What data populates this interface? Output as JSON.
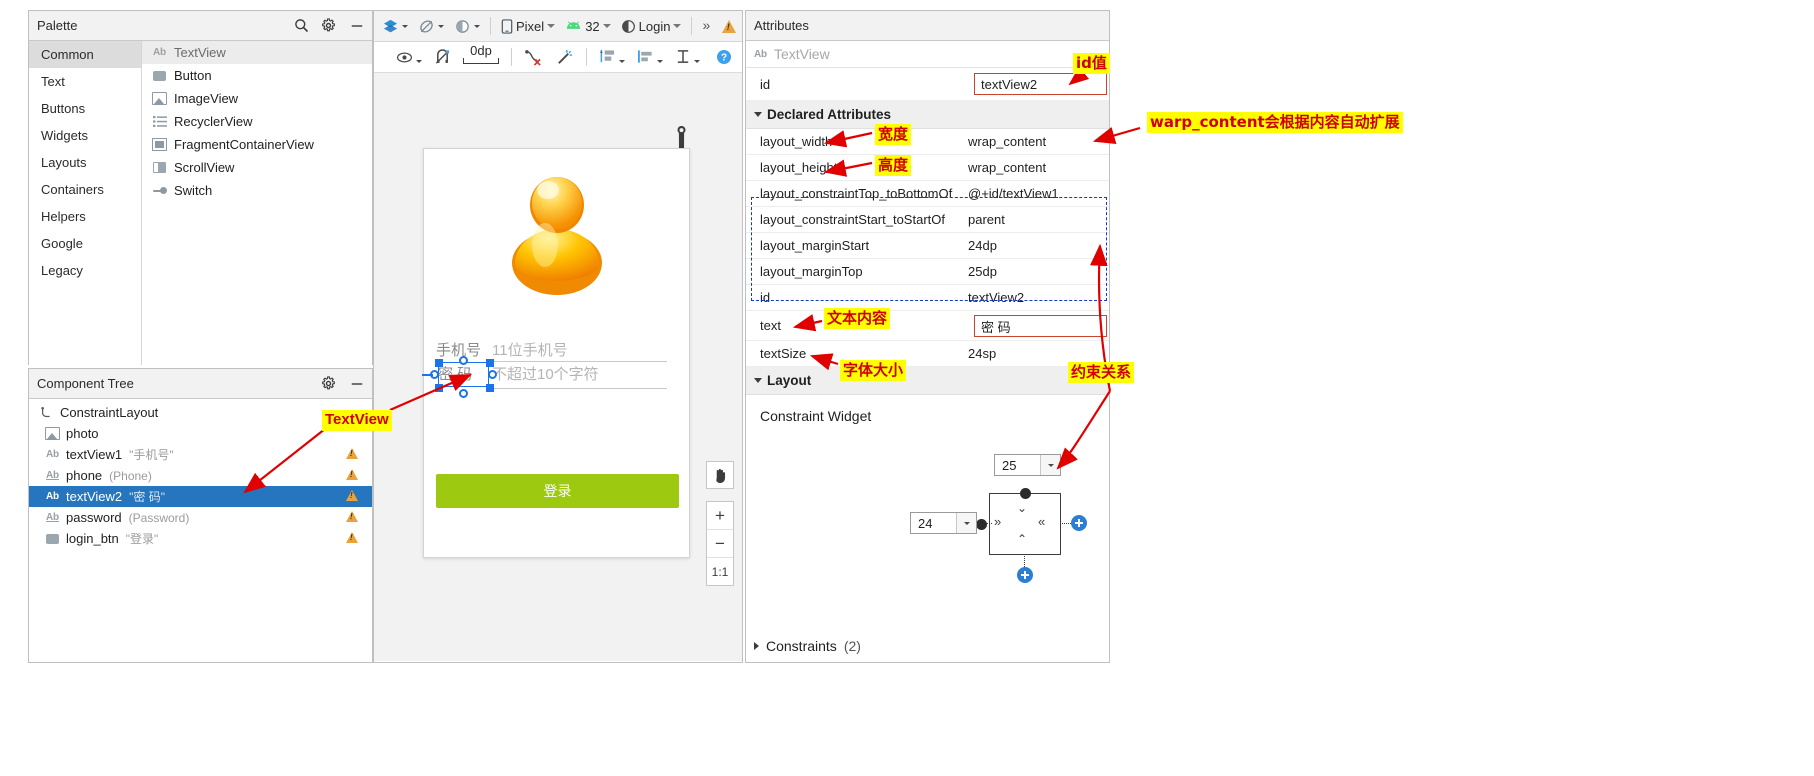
{
  "palette": {
    "title": "Palette",
    "icons": {
      "search": "search-icon",
      "gear": "gear-icon",
      "minimize": "minimize-icon"
    },
    "categories": [
      {
        "label": "Common",
        "selected": true
      },
      {
        "label": "Text",
        "selected": false
      },
      {
        "label": "Buttons",
        "selected": false
      },
      {
        "label": "Widgets",
        "selected": false
      },
      {
        "label": "Layouts",
        "selected": false
      },
      {
        "label": "Containers",
        "selected": false
      },
      {
        "label": "Helpers",
        "selected": false
      },
      {
        "label": "Google",
        "selected": false
      },
      {
        "label": "Legacy",
        "selected": false
      }
    ],
    "items": [
      {
        "label": "TextView",
        "icon": "text-icon",
        "selected": true
      },
      {
        "label": "Button",
        "icon": "button-icon",
        "selected": false
      },
      {
        "label": "ImageView",
        "icon": "image-icon",
        "selected": false
      },
      {
        "label": "RecyclerView",
        "icon": "list-icon",
        "selected": false
      },
      {
        "label": "FragmentContainerView",
        "icon": "fragment-icon",
        "selected": false
      },
      {
        "label": "ScrollView",
        "icon": "scroll-icon",
        "selected": false
      },
      {
        "label": "Switch",
        "icon": "switch-icon",
        "selected": false
      }
    ]
  },
  "component_tree": {
    "title": "Component Tree",
    "icons": {
      "gear": "gear-icon",
      "minimize": "minimize-icon"
    },
    "nodes": [
      {
        "name": "ConstraintLayout",
        "sub": "",
        "icon": "constraint-layout-icon",
        "indent": 0,
        "selected": false,
        "warning": false
      },
      {
        "name": "photo",
        "sub": "",
        "icon": "image-icon",
        "indent": 1,
        "selected": false,
        "warning": false
      },
      {
        "name": "textView1",
        "sub": "\"手机号\"",
        "icon": "text-icon",
        "indent": 1,
        "selected": false,
        "warning": true
      },
      {
        "name": "phone",
        "sub": "(Phone)",
        "icon": "edittext-icon",
        "indent": 1,
        "selected": false,
        "warning": true
      },
      {
        "name": "textView2",
        "sub": "\"密  码\"",
        "icon": "text-icon",
        "indent": 1,
        "selected": true,
        "warning": true
      },
      {
        "name": "password",
        "sub": "(Password)",
        "icon": "edittext-icon",
        "indent": 1,
        "selected": false,
        "warning": true
      },
      {
        "name": "login_btn",
        "sub": "\"登录\"",
        "icon": "button-icon",
        "indent": 1,
        "selected": false,
        "warning": true
      }
    ]
  },
  "design_toolbar": {
    "layers_label": "",
    "device_label": "Pixel",
    "api_label": "32",
    "theme_label": "Login",
    "overflow_label": "»",
    "warning_icon": "warning-icon",
    "icons": [
      "layers-icon",
      "orientation-icon",
      "theme-icon",
      "device-icon",
      "android-icon",
      "contrast-icon"
    ],
    "row2_icons": [
      "eye-icon",
      "magnet-off-icon",
      "margin-0dp-icon",
      "clear-constraints-icon",
      "infer-constraints-icon",
      "pack-icon",
      "align-icon",
      "guideline-icon"
    ],
    "row2_margin": "0dp",
    "help_icon": "help-icon"
  },
  "preview": {
    "phone_label_1": "手机号",
    "phone_hint_1": "11位手机号",
    "phone_label_2": "密  码",
    "phone_hint_2": "不超过10个字符",
    "login_button": "登录",
    "pan_icon": "pan-hand-icon",
    "zoom_in": "+",
    "zoom_out": "−",
    "zoom_level": "1:1",
    "wrench_icon": "wrench-icon"
  },
  "attributes": {
    "title": "Attributes",
    "widget_type": "TextView",
    "widget_icon": "text-icon",
    "id_key": "id",
    "id_value": "textView2",
    "declared_section": "Declared Attributes",
    "layout_section": "Layout",
    "constraint_widget_label": "Constraint Widget",
    "constraints_label": "Constraints",
    "constraints_count": "(2)",
    "rows": [
      {
        "key": "layout_width",
        "value": "wrap_content"
      },
      {
        "key": "layout_height",
        "value": "wrap_content"
      },
      {
        "key": "layout_constraintTop_toBottomOf",
        "value": "@+id/textView1"
      },
      {
        "key": "layout_constraintStart_toStartOf",
        "value": "parent"
      },
      {
        "key": "layout_marginStart",
        "value": "24dp"
      },
      {
        "key": "layout_marginTop",
        "value": "25dp"
      },
      {
        "key": "id",
        "value": "textView2"
      },
      {
        "key": "text",
        "value": "密  码"
      },
      {
        "key": "textSize",
        "value": "24sp"
      }
    ],
    "margin_top_spinner": "25",
    "margin_start_spinner": "24"
  },
  "annotations": [
    {
      "text": "id值",
      "name": "annotation-id-value"
    },
    {
      "text": "warp_content会根据内容自动扩展",
      "name": "annotation-wrap-content"
    },
    {
      "text": "宽度",
      "name": "annotation-width"
    },
    {
      "text": "高度",
      "name": "annotation-height"
    },
    {
      "text": "文本内容",
      "name": "annotation-text-content"
    },
    {
      "text": "字体大小",
      "name": "annotation-font-size"
    },
    {
      "text": "约束关系",
      "name": "annotation-constraints"
    },
    {
      "text": "TextView",
      "name": "annotation-textview"
    }
  ],
  "colors": {
    "selection_blue": "#2675bf",
    "annotation_bg": "#ffff00",
    "annotation_fg": "#d10000",
    "arrow_red": "#e00000",
    "login_green": "#9ec911",
    "warning_amber": "#e8a33d",
    "constraint_blue": "#1138c9"
  }
}
